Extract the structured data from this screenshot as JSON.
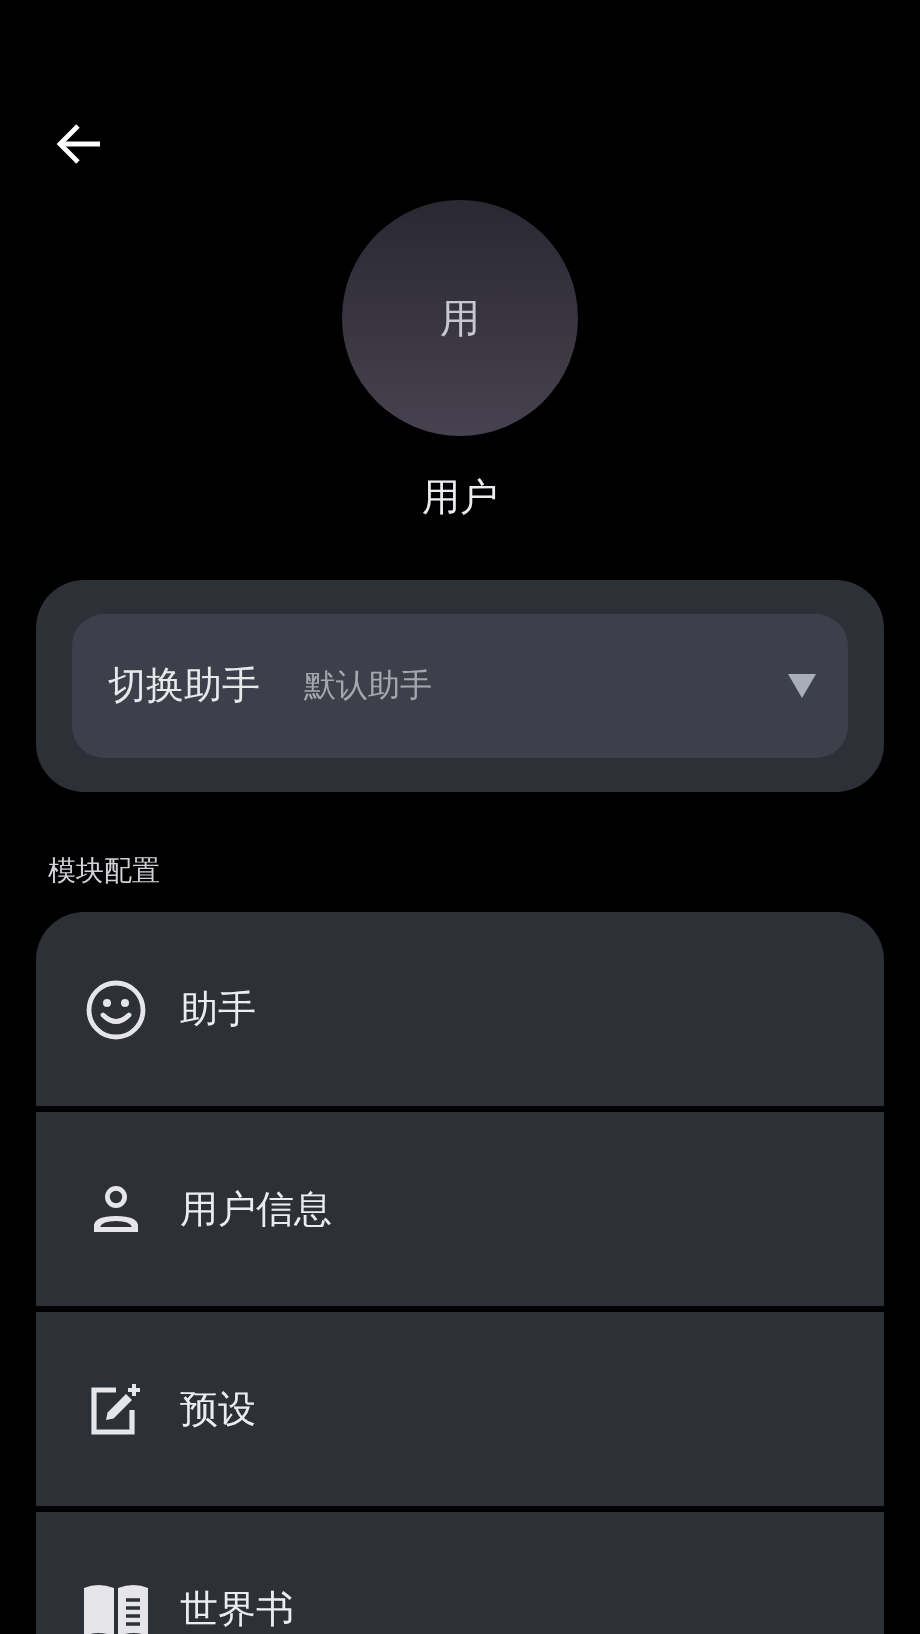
{
  "profile": {
    "avatar_text": "用",
    "name": "用户"
  },
  "assistant_switch": {
    "label": "切换助手",
    "value": "默认助手"
  },
  "section": {
    "title": "模块配置"
  },
  "modules": [
    {
      "label": "助手"
    },
    {
      "label": "用户信息"
    },
    {
      "label": "预设"
    },
    {
      "label": "世界书"
    }
  ]
}
